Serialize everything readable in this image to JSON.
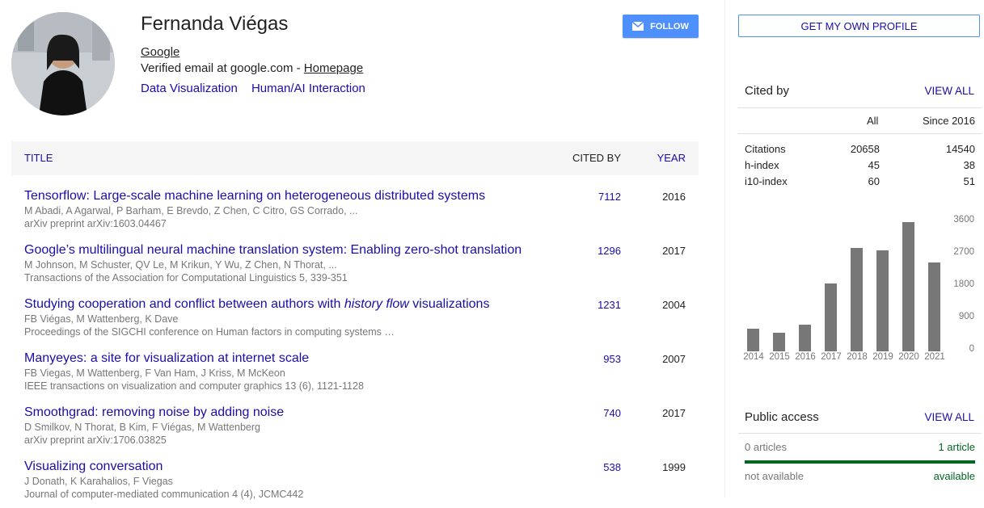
{
  "profile": {
    "name": "Fernanda Viégas",
    "affiliation": "Google",
    "email_text": "Verified email at google.com - ",
    "homepage_label": "Homepage",
    "interests": [
      "Data Visualization",
      "Human/AI Interaction"
    ],
    "follow_label": "FOLLOW"
  },
  "table": {
    "col_title": "TITLE",
    "col_cited": "CITED BY",
    "col_year": "YEAR"
  },
  "articles": [
    {
      "title_pre": "Tensorflow: Large-scale machine learning on heterogeneous distributed systems",
      "title_italic": "",
      "title_post": "",
      "authors": "M Abadi, A Agarwal, P Barham, E Brevdo, Z Chen, C Citro, GS Corrado, ...",
      "venue": "arXiv preprint arXiv:1603.04467",
      "cited": "7112",
      "year": "2016"
    },
    {
      "title_pre": "Google’s multilingual neural machine translation system: Enabling zero-shot translation",
      "title_italic": "",
      "title_post": "",
      "authors": "M Johnson, M Schuster, QV Le, M Krikun, Y Wu, Z Chen, N Thorat, ...",
      "venue": "Transactions of the Association for Computational Linguistics 5, 339-351",
      "cited": "1296",
      "year": "2017"
    },
    {
      "title_pre": "Studying cooperation and conflict between authors with ",
      "title_italic": "history flow",
      "title_post": " visualizations",
      "authors": "FB Viégas, M Wattenberg, K Dave",
      "venue": "Proceedings of the SIGCHI conference on Human factors in computing systems …",
      "cited": "1231",
      "year": "2004"
    },
    {
      "title_pre": "Manyeyes: a site for visualization at internet scale",
      "title_italic": "",
      "title_post": "",
      "authors": "FB Viegas, M Wattenberg, F Van Ham, J Kriss, M McKeon",
      "venue": "IEEE transactions on visualization and computer graphics 13 (6), 1121-1128",
      "cited": "953",
      "year": "2007"
    },
    {
      "title_pre": "Smoothgrad: removing noise by adding noise",
      "title_italic": "",
      "title_post": "",
      "authors": "D Smilkov, N Thorat, B Kim, F Viégas, M Wattenberg",
      "venue": "arXiv preprint arXiv:1706.03825",
      "cited": "740",
      "year": "2017"
    },
    {
      "title_pre": "Visualizing conversation",
      "title_italic": "",
      "title_post": "",
      "authors": "J Donath, K Karahalios, F Viegas",
      "venue": "Journal of computer-mediated communication 4 (4), JCMC442",
      "cited": "538",
      "year": "1999"
    }
  ],
  "sidebar": {
    "own_profile_label": "GET MY OWN PROFILE",
    "cited_by_title": "Cited by",
    "view_all_label": "VIEW ALL",
    "col_all": "All",
    "col_since": "Since 2016",
    "metrics": [
      {
        "label": "Citations",
        "all": "20658",
        "since": "14540"
      },
      {
        "label": "h-index",
        "all": "45",
        "since": "38"
      },
      {
        "label": "i10-index",
        "all": "60",
        "since": "51"
      }
    ],
    "public_access_title": "Public access",
    "pa_left_count": "0 articles",
    "pa_right_count": "1 article",
    "pa_left_label": "not available",
    "pa_right_label": "available"
  },
  "chart_data": {
    "type": "bar",
    "categories": [
      "2014",
      "2015",
      "2016",
      "2017",
      "2018",
      "2019",
      "2020",
      "2021"
    ],
    "values": [
      620,
      510,
      750,
      1880,
      2880,
      2820,
      3600,
      2480
    ],
    "ylim": [
      0,
      3600
    ],
    "yticks": [
      "3600",
      "2700",
      "1800",
      "900",
      "0"
    ],
    "bar_color": "#777777"
  },
  "colors": {
    "link": "#1a0dab",
    "follow": "#4d90fe",
    "available": "#006621"
  }
}
